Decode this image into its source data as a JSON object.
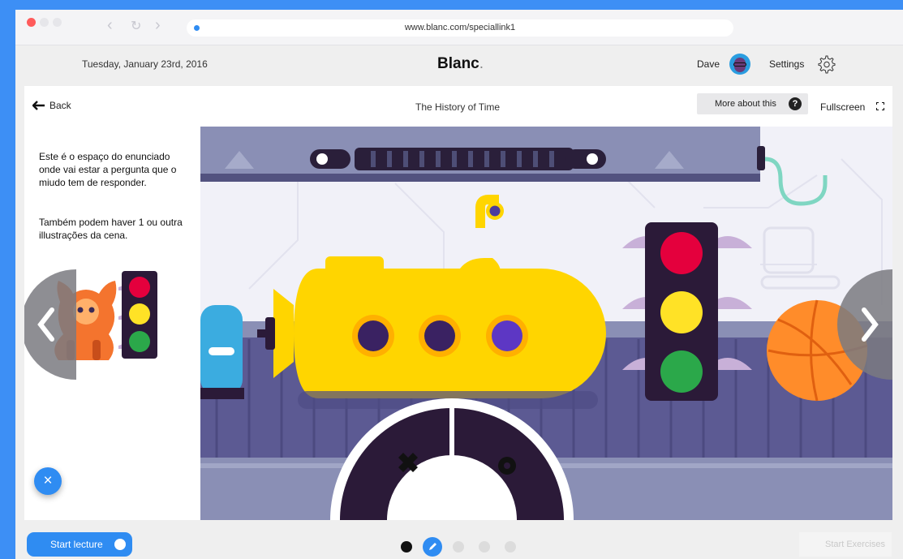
{
  "browser": {
    "url": "www.blanc.com/speciallink1",
    "window_controls": [
      "close",
      "minimize",
      "maximize"
    ],
    "nav_icons": [
      "chevron-left-icon",
      "refresh-icon",
      "chevron-right-icon"
    ]
  },
  "header": {
    "date": "Tuesday, January 23rd, 2016",
    "brand": "Blanc",
    "brand_suffix": ".",
    "user_name": "Dave",
    "settings_label": "Settings"
  },
  "lesson": {
    "back_label": "Back",
    "title": "The History of Time",
    "more_label": "More about this",
    "help_glyph": "?",
    "fullscreen_label": "Fullscreen"
  },
  "question": {
    "text": "Este é o espaço do enunciado onde vai estar a pergunta que o miudo tem de responder.",
    "note": "Também podem haver 1 ou outra illustrações da cena."
  },
  "controls": {
    "prev_glyph": "❮",
    "next_glyph": "❯",
    "close_glyph": "×"
  },
  "footer": {
    "start_lecture": "Start lecture",
    "start_exercises": "Start Exercises",
    "pages": [
      {
        "state": "done"
      },
      {
        "state": "current"
      },
      {
        "state": "pending"
      },
      {
        "state": "pending"
      },
      {
        "state": "pending"
      }
    ]
  },
  "colors": {
    "accent": "#2f8cf2",
    "background": "#3d8ff5",
    "scene_bg": "#6f6fa8",
    "submarine": "#ffd500",
    "traffic_red": "#e4003d",
    "traffic_yellow": "#ffe226",
    "traffic_green": "#2ba84a",
    "basketball": "#ff8c2a"
  }
}
